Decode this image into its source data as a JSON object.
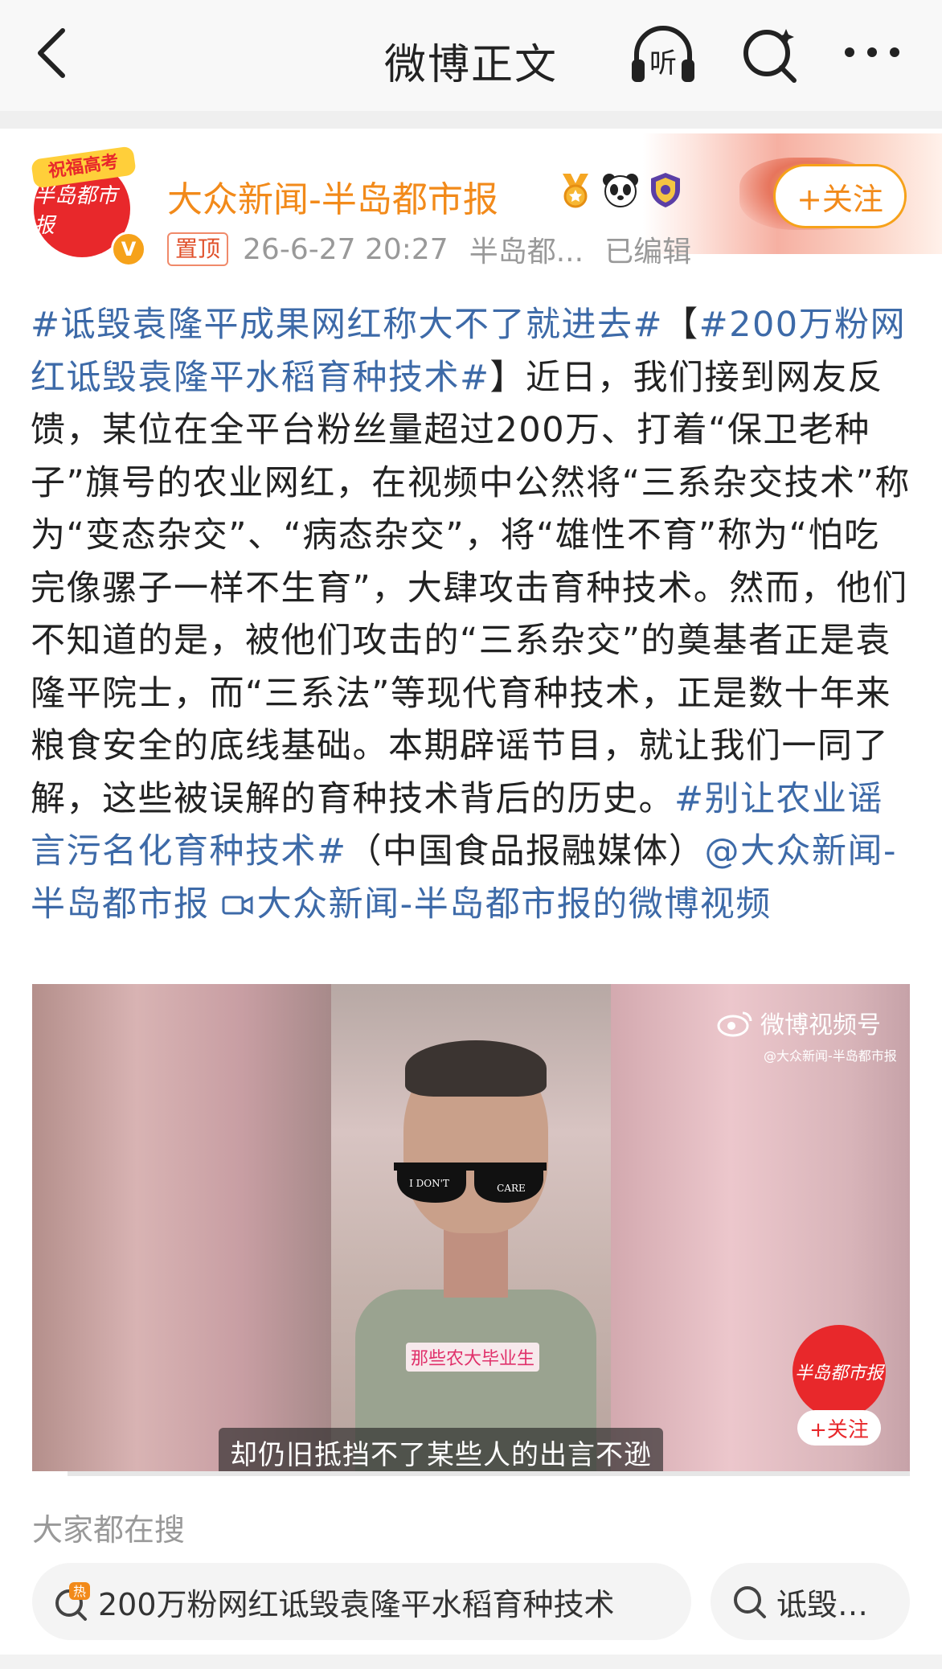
{
  "nav": {
    "title": "微博正文",
    "listen_label": "听"
  },
  "post": {
    "author": "大众新闻-半岛都市报",
    "avatar_text": "半岛都市报",
    "avatar_ribbon": "祝福高考",
    "verified_badge": "V",
    "follow_label": "+关注",
    "pinned_label": "置顶",
    "time": "26-6-27 20:27",
    "source": "半岛都...",
    "edited": "已编辑",
    "segments": [
      {
        "text": "#诋毁袁隆平成果网红称大不了就进去#",
        "link": true
      },
      {
        "text": "【",
        "link": false
      },
      {
        "text": "#200万粉网红诋毁袁隆平水稻育种技术#",
        "link": true
      },
      {
        "text": "】近日，我们接到网友反馈，某位在全平台粉丝量超过200万、打着“保卫老种子”旗号的农业网红，在视频中公然将“三系杂交技术”称为“变态杂交”、“病态杂交”，将“雄性不育”称为“怕吃完像骡子一样不生育”，大肆攻击育种技术。然而，他们不知道的是，被他们攻击的“三系杂交”的奠基者正是袁隆平院士，而“三系法”等现代育种技术，正是数十年来粮食安全的底线基础。本期辟谣节目，就让我们一同了解，这些被误解的育种技术背后的历史。",
        "link": false
      },
      {
        "text": "#别让农业谣言污名化育种技术#",
        "link": true
      },
      {
        "text": "（中国食品报融媒体）",
        "link": false
      },
      {
        "text": "@大众新闻-半岛都市报",
        "link": true
      },
      {
        "text": " ",
        "link": false
      },
      {
        "text": "大众新闻-半岛都市报的微博视频",
        "link": true,
        "icon": "video-camera-icon"
      }
    ]
  },
  "video": {
    "watermark_title": "微博视频号",
    "watermark_sub": "@大众新闻-半岛都市报",
    "glasses_left": "I DON'T",
    "glasses_right": "CARE",
    "on_screen_label": "那些农大毕业生",
    "subtitle": "却仍旧抵挡不了某些人的出言不逊",
    "logo_text": "半岛都市报",
    "follow_label": "+关注",
    "progress": 0.04
  },
  "trending": {
    "label": "大家都在搜",
    "chips": [
      {
        "text": "200万粉网红诋毁袁隆平水稻育种技术",
        "icon": "hot-search-icon",
        "hot": "热"
      },
      {
        "text": "诋毁…",
        "icon": "search-icon"
      }
    ]
  },
  "colors": {
    "link": "#3d6aa8",
    "username": "#f28a1a",
    "accent_red": "#e8282b"
  }
}
